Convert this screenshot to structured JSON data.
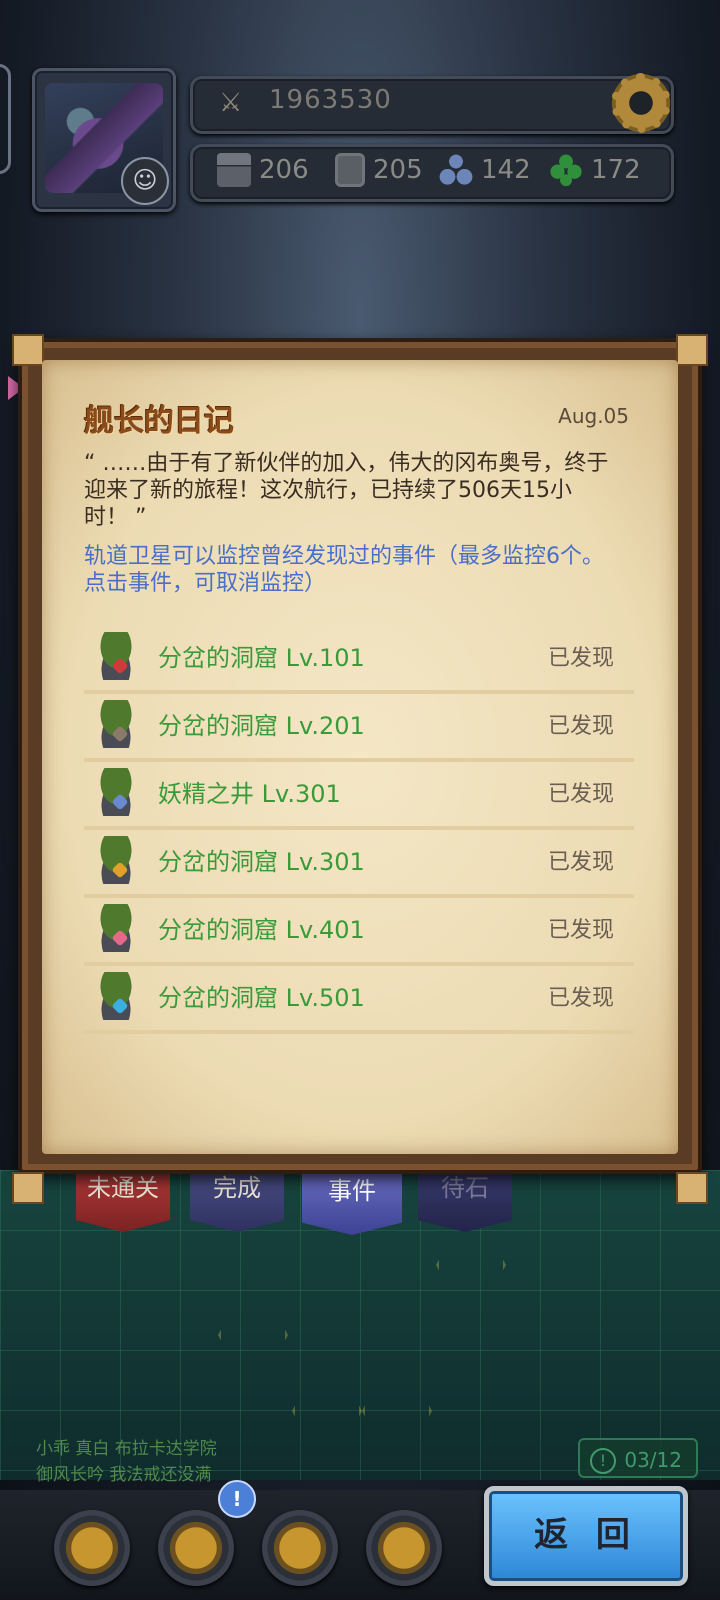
{
  "hud": {
    "power": "1963530",
    "resources": [
      {
        "icon": "tank-icon",
        "value": "206"
      },
      {
        "icon": "document-icon",
        "value": "205"
      },
      {
        "icon": "propeller-icon",
        "value": "142"
      },
      {
        "icon": "clover-icon",
        "value": "172"
      }
    ]
  },
  "diary": {
    "title": "舰长的日记",
    "date": "Aug.05",
    "quote": "“ ……由于有了新伙伴的加入，伟大的冈布奥号，终于迎来了新的旅程！这次航行，已持续了506天15小时！ ”",
    "note": "轨道卫星可以监控曾经发现过的事件（最多监控6个。点击事件，可取消监控）"
  },
  "events": [
    {
      "name": "分岔的洞窟 Lv.101",
      "status": "已发现",
      "gem": "#d13a3a"
    },
    {
      "name": "分岔的洞窟 Lv.201",
      "status": "已发现",
      "gem": "#8a7a6a"
    },
    {
      "name": "妖精之井 Lv.301",
      "status": "已发现",
      "gem": "#6a8ad0"
    },
    {
      "name": "分岔的洞窟 Lv.301",
      "status": "已发现",
      "gem": "#e0a02a"
    },
    {
      "name": "分岔的洞窟 Lv.401",
      "status": "已发现",
      "gem": "#e56a8a"
    },
    {
      "name": "分岔的洞窟 Lv.501",
      "status": "已发现",
      "gem": "#3ab0e0"
    }
  ],
  "tabs": {
    "uncleared": "未通关",
    "done": "完成",
    "events": "事件",
    "pending": "待石"
  },
  "feed": {
    "line1": "小乖 真白  布拉卡达学院",
    "line2": "御风长吟  我法戒还没满"
  },
  "counter": "03/12",
  "nav_badge": "!",
  "back_label": "返 回"
}
